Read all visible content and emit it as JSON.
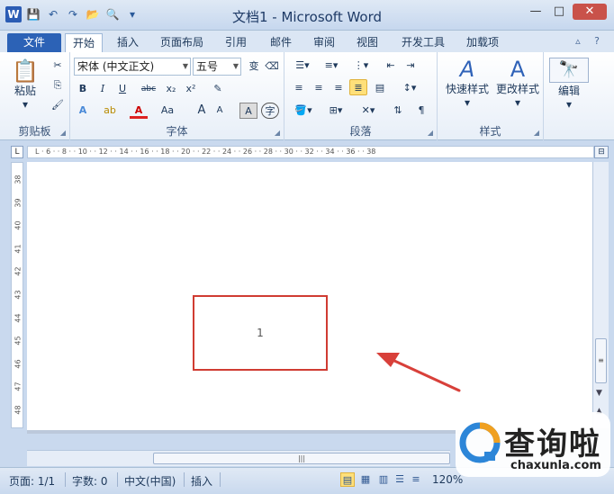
{
  "window": {
    "title": "文档1 - Microsoft Word",
    "app_letter": "W"
  },
  "quick_access": {
    "save_glyph": "💾",
    "undo_glyph": "↶",
    "redo_glyph": "↷",
    "open_glyph": "📂",
    "preview_glyph": "🔍",
    "more_glyph": "▾"
  },
  "tabs": [
    {
      "label": "文件"
    },
    {
      "label": "开始"
    },
    {
      "label": "插入"
    },
    {
      "label": "页面布局"
    },
    {
      "label": "引用"
    },
    {
      "label": "邮件"
    },
    {
      "label": "审阅"
    },
    {
      "label": "视图"
    },
    {
      "label": "开发工具"
    },
    {
      "label": "加载项"
    }
  ],
  "ribbon": {
    "clipboard": {
      "label": "剪贴板",
      "paste": "粘贴"
    },
    "font": {
      "label": "字体",
      "font_name": "宋体 (中文正文)",
      "font_size": "五号",
      "bold": "B",
      "italic": "I",
      "underline": "U",
      "strike": "abc",
      "subscript": "x₂",
      "superscript": "x²",
      "grow": "A",
      "shrink": "A",
      "case": "Aa",
      "char_border": "A",
      "enclose": "字",
      "phonetic": "变"
    },
    "paragraph": {
      "label": "段落"
    },
    "styles": {
      "label": "样式",
      "quick_styles": "快速样式",
      "change_styles": "更改样式"
    },
    "editing": {
      "label": "编辑",
      "edit": "编辑"
    }
  },
  "ruler": {
    "h_numbers": "L  ·  6  ·  ·  8  ·  ·  10  ·  ·  12  ·  ·  14  ·  ·  16  ·  ·  18  ·  ·  20  ·  ·  22  ·  ·  24  ·  ·  26  ·  ·  28  ·  ·  30  ·  ·  32  ·  ·  34  ·  ·  36  ·  ·  38",
    "v_numbers": [
      "38",
      "39",
      "40",
      "41",
      "42",
      "43",
      "44",
      "45",
      "46",
      "47",
      "48",
      "49"
    ]
  },
  "document": {
    "textbox_content": "1"
  },
  "status": {
    "page": "页面: 1/1",
    "words": "字数: 0",
    "language": "中文(中国)",
    "mode": "插入",
    "zoom": "120%"
  },
  "watermark": {
    "text": "查询啦",
    "url": "chaxunla.com"
  }
}
